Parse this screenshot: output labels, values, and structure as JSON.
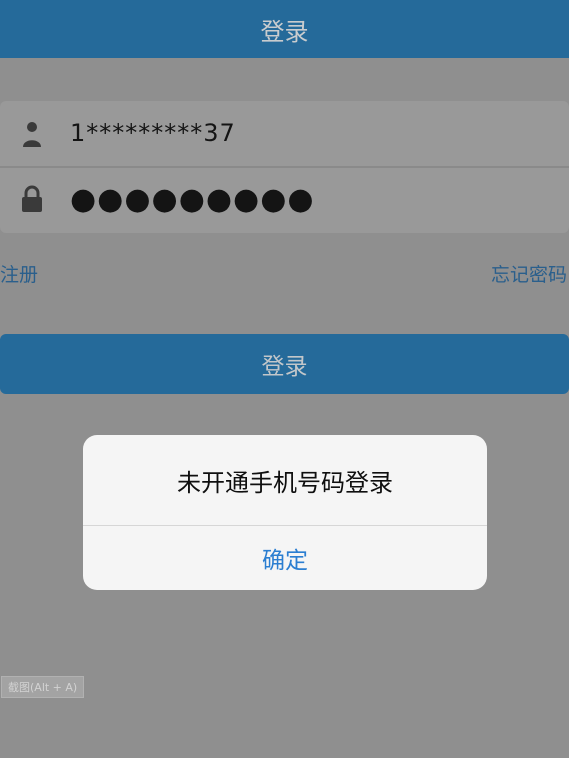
{
  "header": {
    "title": "登录"
  },
  "form": {
    "username": {
      "icon": "user-icon",
      "value": "1*********37"
    },
    "password": {
      "icon": "lock-icon",
      "value": "●●●●●●●●●"
    }
  },
  "links": {
    "register": "注册",
    "forgot_password": "忘记密码"
  },
  "login_button": {
    "label": "登录"
  },
  "dialog": {
    "message": "未开通手机号码登录",
    "confirm_label": "确定"
  },
  "screenshot_hint": {
    "label": "截图(Alt + A)"
  },
  "colors": {
    "header_bg": "#256a9a",
    "overlay_bg": "#8f8f8f",
    "link": "#2a5f8c",
    "dialog_bg": "#f5f5f5",
    "dialog_action": "#2b7ed1"
  }
}
